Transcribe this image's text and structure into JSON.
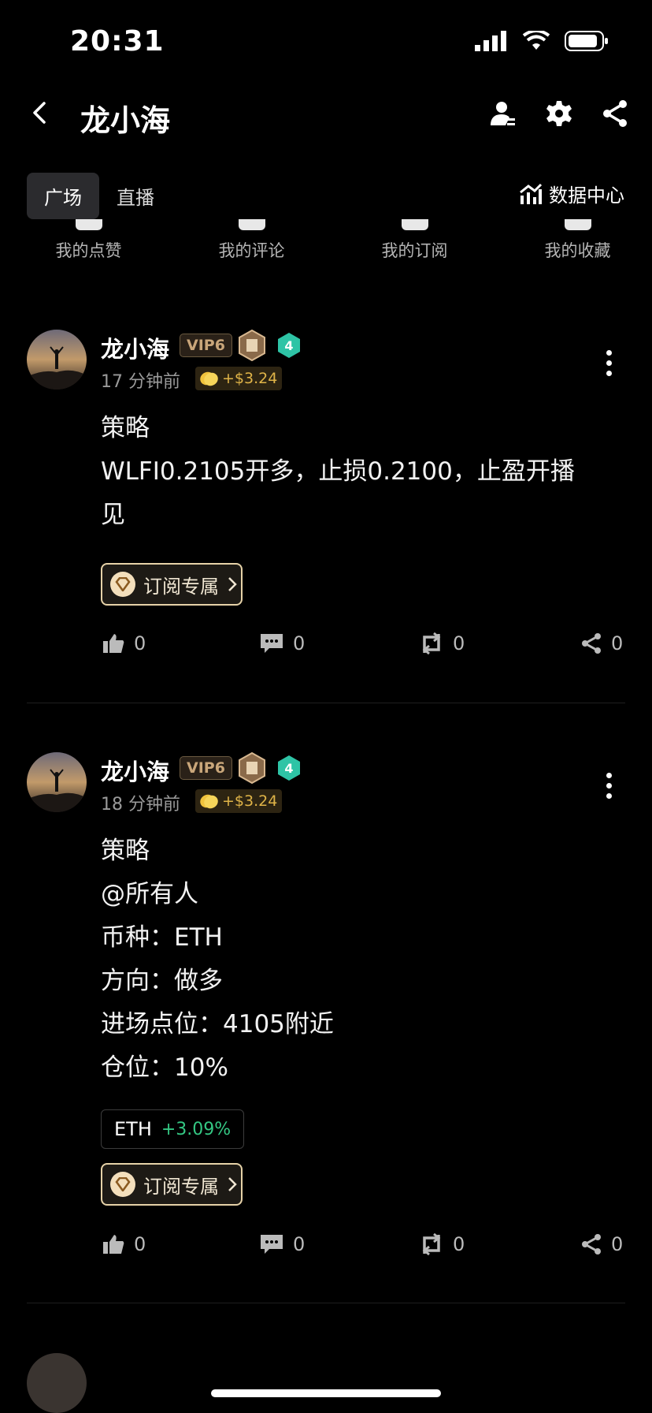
{
  "status_bar": {
    "time": "20:31"
  },
  "nav": {
    "title": "龙小海"
  },
  "tabs": [
    {
      "label": "广场"
    },
    {
      "label": "直播"
    }
  ],
  "data_center": {
    "label": "数据中心"
  },
  "quick_links": [
    {
      "label": "我的点赞"
    },
    {
      "label": "我的评论"
    },
    {
      "label": "我的订阅"
    },
    {
      "label": "我的收藏"
    }
  ],
  "posts": [
    {
      "author": "龙小海",
      "vip": "VIP6",
      "level": "4",
      "time": "17 分钟前",
      "reward": "+$3.24",
      "lines": [
        "策略",
        "WLFI0.2105开多，止损0.2100，止盈开播",
        "见"
      ],
      "subscribe_label": "订阅专属",
      "likes": "0",
      "comments": "0",
      "reposts": "0",
      "shares": "0"
    },
    {
      "author": "龙小海",
      "vip": "VIP6",
      "level": "4",
      "time": "18 分钟前",
      "reward": "+$3.24",
      "lines": [
        "策略",
        "@所有人",
        "币种：ETH",
        "方向：做多",
        "进场点位：4105附近",
        "仓位：10%"
      ],
      "coin": {
        "symbol": "ETH",
        "change": "+3.09%"
      },
      "subscribe_label": "订阅专属",
      "likes": "0",
      "comments": "0",
      "reposts": "0",
      "shares": "0"
    }
  ]
}
